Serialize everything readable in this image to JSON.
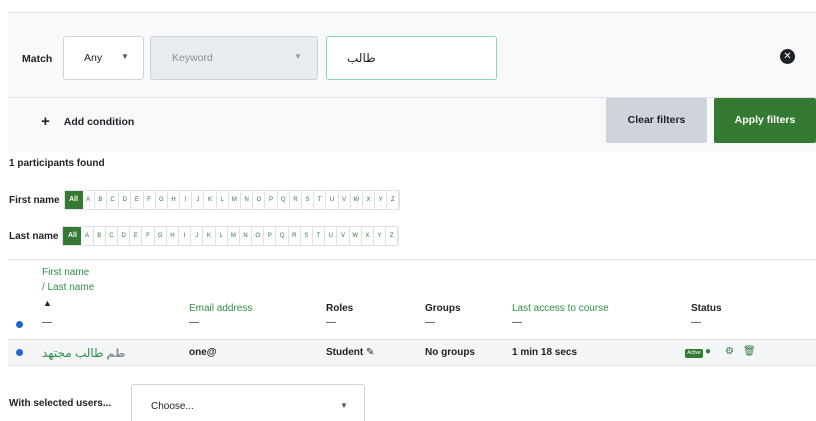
{
  "filters": {
    "match_label": "Match",
    "match_value": "Any",
    "type_value": "Keyword",
    "keyword_value": "طالب",
    "add_condition": "Add condition",
    "clear_label": "Clear filters",
    "apply_label": "Apply filters"
  },
  "summary": {
    "found": "1 participants found"
  },
  "initials": {
    "first_label": "First name",
    "last_label": "Last name",
    "all": "All",
    "letters": [
      "A",
      "B",
      "C",
      "D",
      "E",
      "F",
      "G",
      "H",
      "I",
      "J",
      "K",
      "L",
      "M",
      "N",
      "O",
      "P",
      "Q",
      "R",
      "S",
      "T",
      "U",
      "V",
      "W",
      "X",
      "Y",
      "Z"
    ]
  },
  "table": {
    "headers": {
      "first_name": "First name",
      "last_name": "/ Last name",
      "email": "Email address",
      "roles": "Roles",
      "groups": "Groups",
      "last_access": "Last access to course",
      "status": "Status"
    },
    "dash": "—",
    "rows": [
      {
        "name": "طالب مجتهد",
        "avatar": "طم",
        "email": "one@",
        "role": "Student",
        "groups": "No groups",
        "last_access": "1 min 18 secs",
        "status_badge": "Active"
      }
    ]
  },
  "bulk": {
    "label": "With selected users...",
    "select_value": "Choose..."
  },
  "colors": {
    "accent": "#357a32",
    "link": "#2f8f46",
    "checkbox": "#2166d1"
  }
}
